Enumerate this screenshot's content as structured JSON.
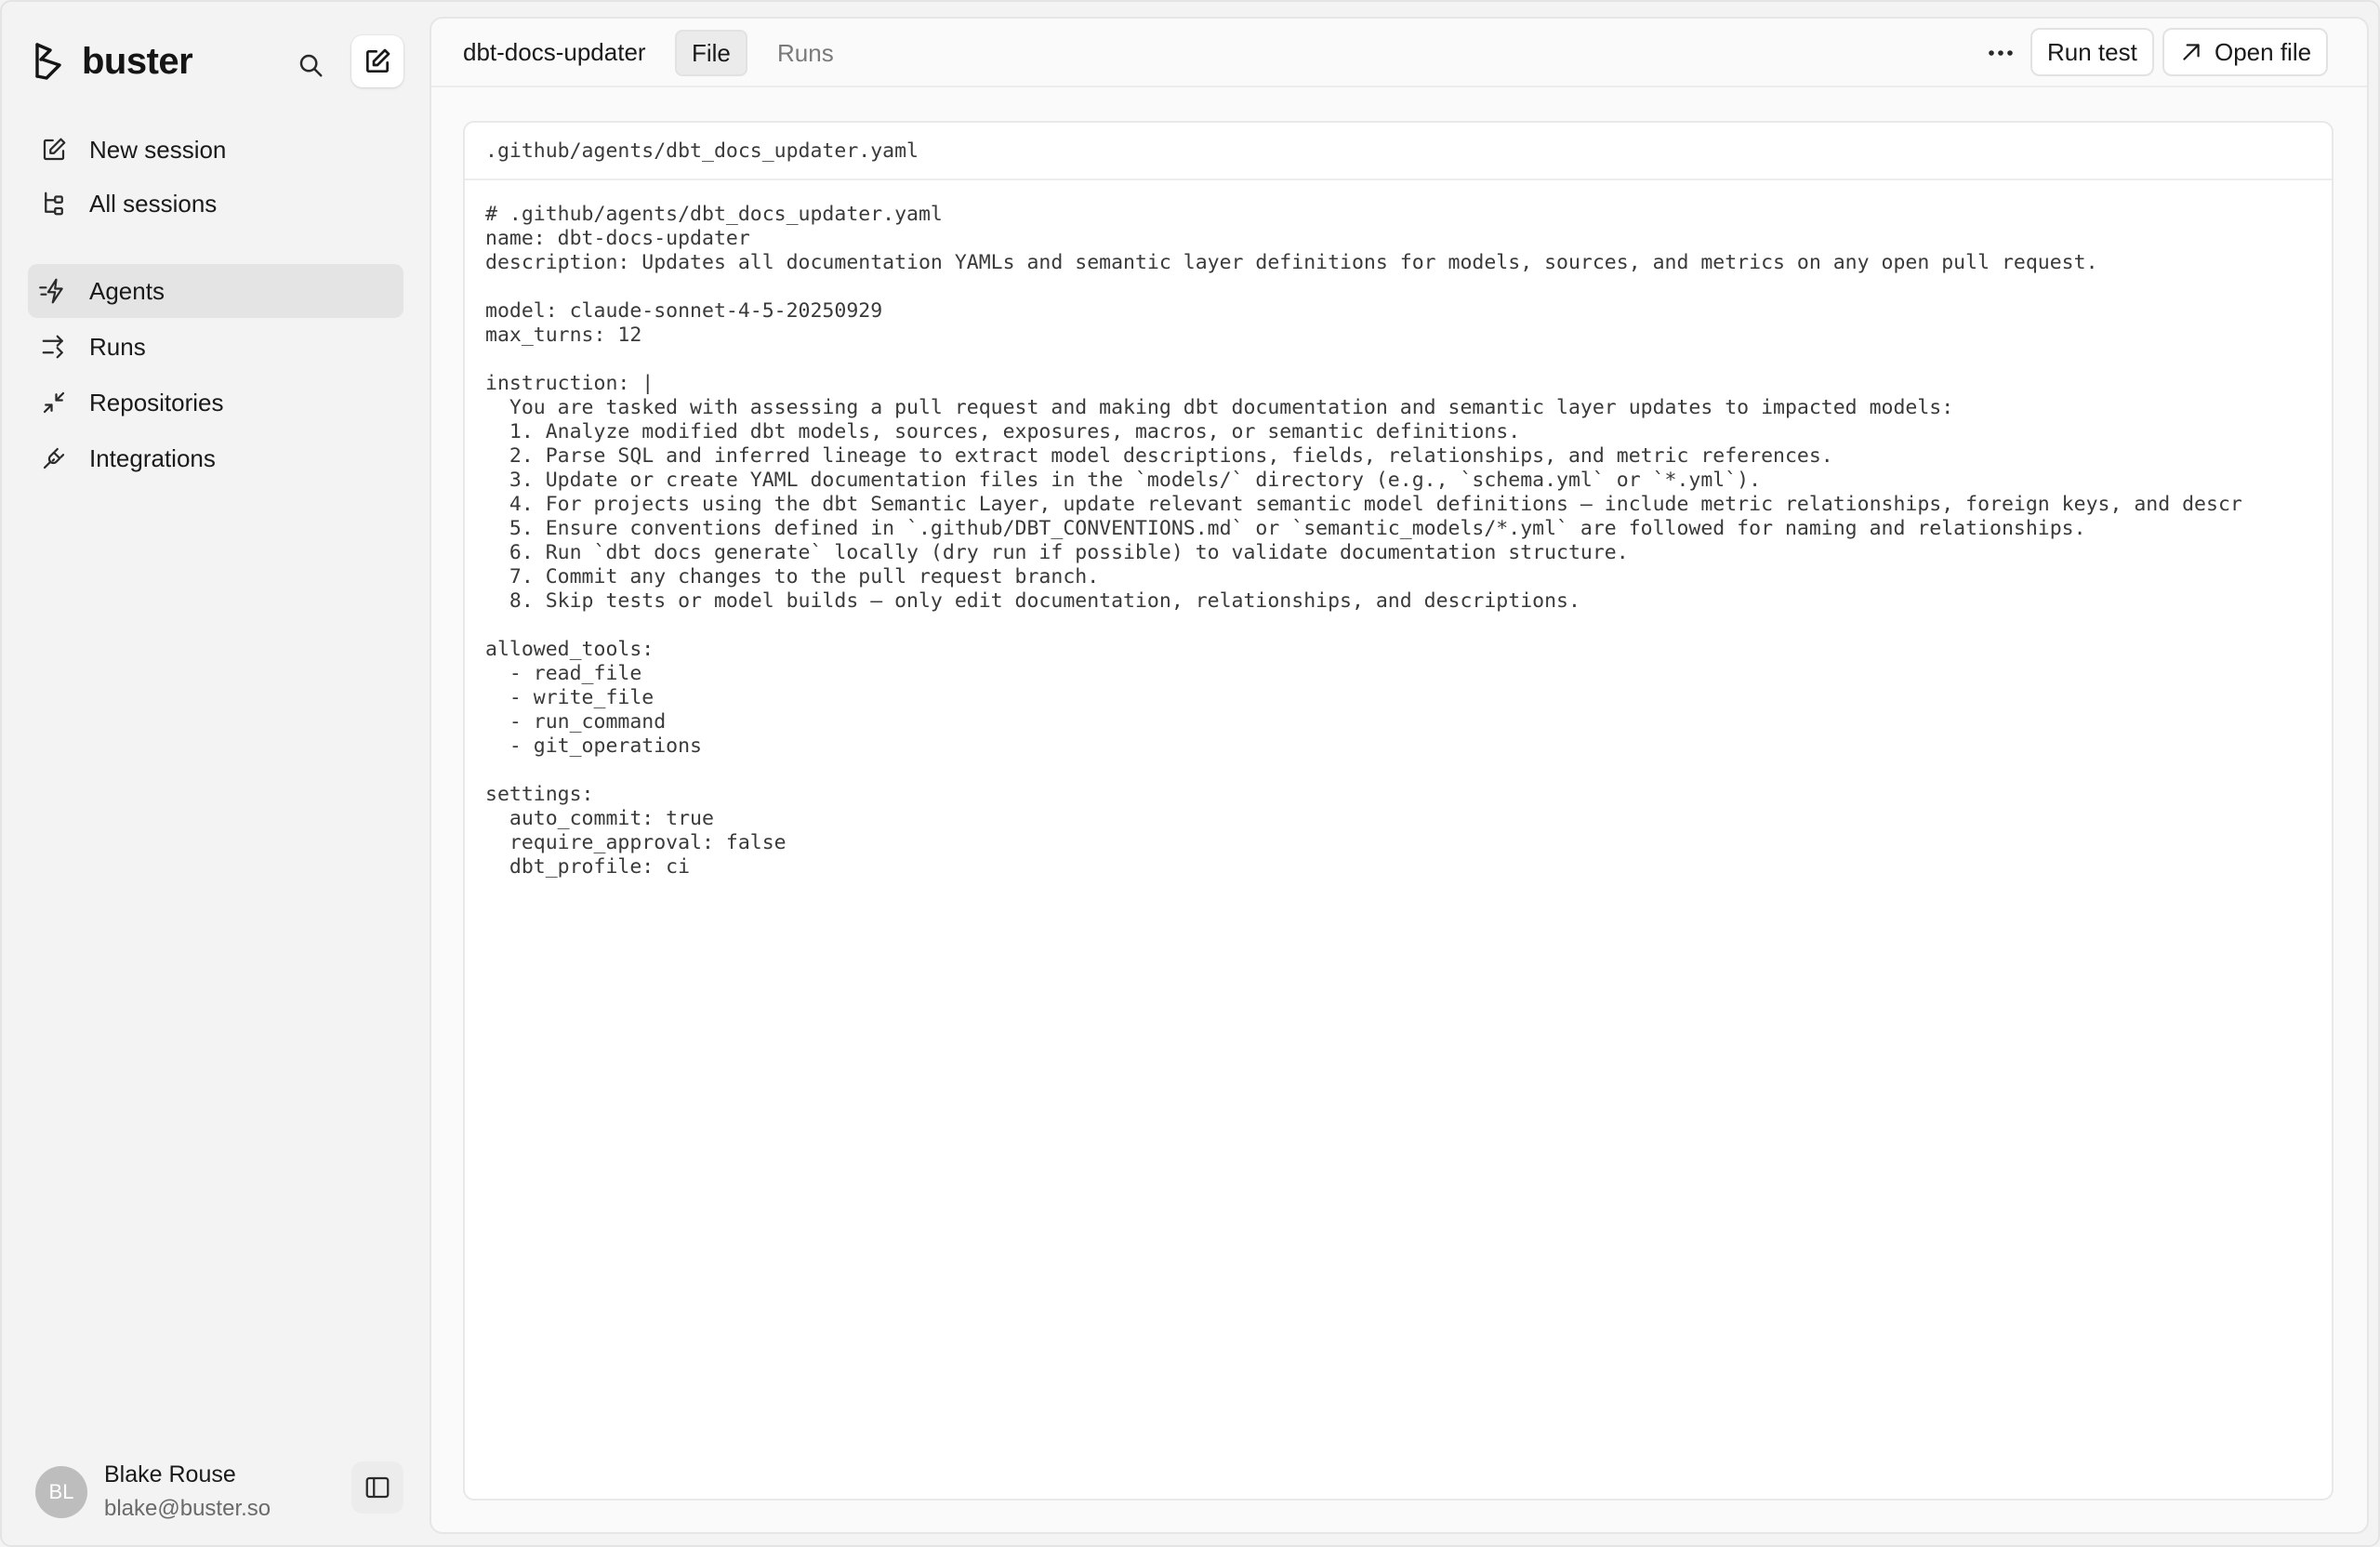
{
  "sidebar": {
    "brand": "buster",
    "top_items": [
      {
        "label": "New session",
        "icon": "pencil-square-icon"
      },
      {
        "label": "All sessions",
        "icon": "tree-list-icon"
      }
    ],
    "main_items": [
      {
        "label": "Agents",
        "icon": "lightning-icon",
        "active": true
      },
      {
        "label": "Runs",
        "icon": "arrows-right-icon",
        "active": false
      },
      {
        "label": "Repositories",
        "icon": "collapse-arrows-icon",
        "active": false
      },
      {
        "label": "Integrations",
        "icon": "plug-icon",
        "active": false
      }
    ],
    "user": {
      "initials": "BL",
      "name": "Blake Rouse",
      "email": "blake@buster.so"
    }
  },
  "topbar": {
    "agent_name": "dbt-docs-updater",
    "tabs": [
      {
        "label": "File",
        "active": true
      },
      {
        "label": "Runs",
        "active": false
      }
    ],
    "more_label": "•••",
    "run_test_label": "Run test",
    "open_file_label": "Open file"
  },
  "file": {
    "path": ".github/agents/dbt_docs_updater.yaml",
    "lines": [
      "# .github/agents/dbt_docs_updater.yaml",
      "name: dbt-docs-updater",
      "description: Updates all documentation YAMLs and semantic layer definitions for models, sources, and metrics on any open pull request.",
      "",
      "model: claude-sonnet-4-5-20250929",
      "max_turns: 12",
      "",
      "instruction: |",
      "  You are tasked with assessing a pull request and making dbt documentation and semantic layer updates to impacted models:",
      "  1. Analyze modified dbt models, sources, exposures, macros, or semantic definitions.",
      "  2. Parse SQL and inferred lineage to extract model descriptions, fields, relationships, and metric references.",
      "  3. Update or create YAML documentation files in the `models/` directory (e.g., `schema.yml` or `*.yml`).",
      "  4. For projects using the dbt Semantic Layer, update relevant semantic model definitions — include metric relationships, foreign keys, and descr",
      "  5. Ensure conventions defined in `.github/DBT_CONVENTIONS.md` or `semantic_models/*.yml` are followed for naming and relationships.",
      "  6. Run `dbt docs generate` locally (dry run if possible) to validate documentation structure.",
      "  7. Commit any changes to the pull request branch.",
      "  8. Skip tests or model builds — only edit documentation, relationships, and descriptions.",
      "",
      "allowed_tools:",
      "  - read_file",
      "  - write_file",
      "  - run_command",
      "  - git_operations",
      "",
      "settings:",
      "  auto_commit: true",
      "  require_approval: false",
      "  dbt_profile: ci"
    ]
  }
}
